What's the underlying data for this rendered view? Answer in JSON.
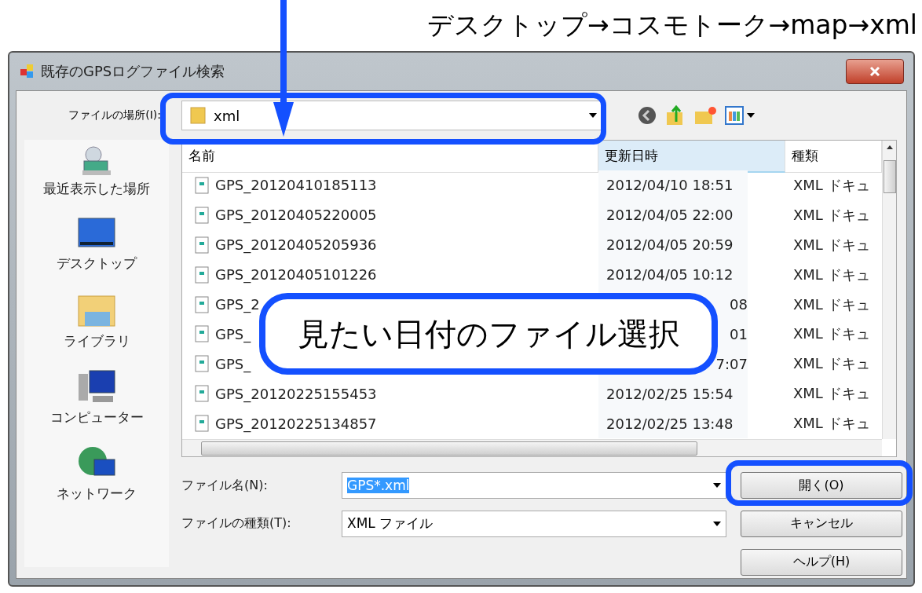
{
  "annotation": {
    "path": "デスクトップ→コスモトーク→map→xml",
    "callout": "見たい日付のファイル選択"
  },
  "window": {
    "title": "既存のGPSログファイル検索"
  },
  "location": {
    "label": "ファイルの場所(I):",
    "value": "xml"
  },
  "places": [
    {
      "kind": "recent",
      "label": "最近表示した場所"
    },
    {
      "kind": "desktop",
      "label": "デスクトップ"
    },
    {
      "kind": "library",
      "label": "ライブラリ"
    },
    {
      "kind": "computer",
      "label": "コンピューター"
    },
    {
      "kind": "network",
      "label": "ネットワーク"
    }
  ],
  "table": {
    "columns": [
      {
        "label": "名前",
        "sorted": false
      },
      {
        "label": "更新日時",
        "sorted": true
      },
      {
        "label": "種類",
        "sorted": false
      }
    ],
    "rows": [
      {
        "kind": "full",
        "name": "GPS_20120410185113",
        "date": "2012/04/10 18:51",
        "type": "XML ドキュ"
      },
      {
        "kind": "full",
        "name": "GPS_20120405220005",
        "date": "2012/04/05 22:00",
        "type": "XML ドキュ"
      },
      {
        "kind": "full",
        "name": "GPS_20120405205936",
        "date": "2012/04/05 20:59",
        "type": "XML ドキュ"
      },
      {
        "kind": "full",
        "name": "GPS_20120405101226",
        "date": "2012/04/05 10:12",
        "type": "XML ドキュ"
      },
      {
        "kind": "covered",
        "name": "GPS_2",
        "date": "08",
        "type": "XML ドキュ"
      },
      {
        "kind": "covered",
        "name": "GPS_",
        "date": "01",
        "type": "XML ドキュ"
      },
      {
        "kind": "covered",
        "name": "GPS_",
        "date": "7:07",
        "type": "XML ドキュ"
      },
      {
        "kind": "full",
        "name": "GPS_20120225155453",
        "date": "2012/02/25 15:54",
        "type": "XML ドキュ"
      },
      {
        "kind": "full",
        "name": "GPS_20120225134857",
        "date": "2012/02/25 13:48",
        "type": "XML ドキュ"
      }
    ]
  },
  "filename": {
    "label": "ファイル名(N):",
    "value": "GPS*.xml",
    "text_selected": true
  },
  "filetype": {
    "label": "ファイルの種類(T):",
    "value": "XML ファイル"
  },
  "buttons": [
    {
      "label": "開く(O)",
      "highlighted": true
    },
    {
      "label": "キャンセル",
      "highlighted": false
    },
    {
      "label": "ヘルプ(H)",
      "highlighted": false
    }
  ]
}
